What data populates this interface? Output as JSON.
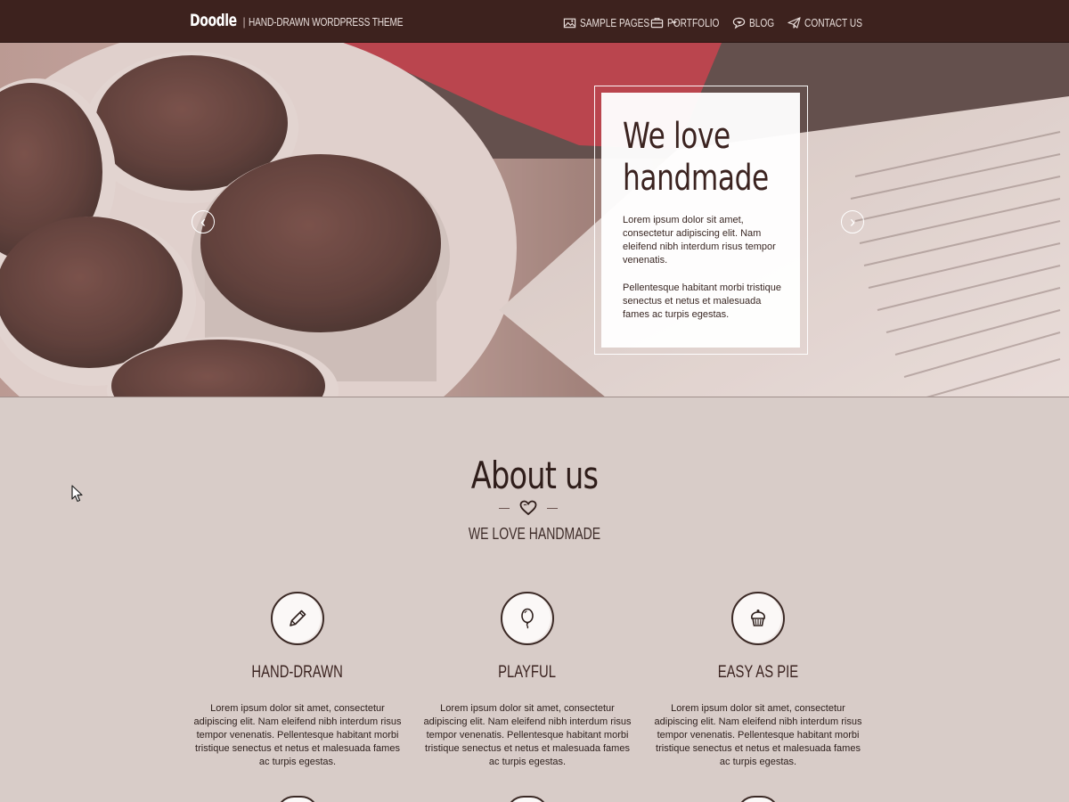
{
  "header": {
    "brand": "Doodle",
    "separator": "|",
    "tagline": "HAND-DRAWN WORDPRESS THEME",
    "nav": [
      {
        "label": "SAMPLE PAGES",
        "icon": "image-icon",
        "dropdown": true
      },
      {
        "label": "PORTFOLIO",
        "icon": "briefcase-icon",
        "dropdown": true
      },
      {
        "label": "BLOG",
        "icon": "speech-bubble-icon",
        "dropdown": false
      },
      {
        "label": "CONTACT US",
        "icon": "paper-plane-icon",
        "dropdown": false
      }
    ]
  },
  "hero": {
    "title_line1": "We love",
    "title_line2": "handmade",
    "paragraph1": "Lorem ipsum dolor sit amet, consectetur adipiscing elit. Nam eleifend nibh interdum risus tempor venenatis.",
    "paragraph2": "Pellentesque habitant morbi tristique senectus et netus et malesuada fames ac turpis egestas.",
    "prev_icon": "chevron-left-icon",
    "next_icon": "chevron-right-icon",
    "prev_glyph": "‹",
    "next_glyph": "›"
  },
  "about": {
    "title": "About us",
    "subtitle": "WE LOVE HANDMADE",
    "divider_icon": "heart-icon",
    "features": [
      {
        "icon": "pencil-icon",
        "title": "HAND-DRAWN",
        "text": "Lorem ipsum dolor sit amet, consectetur adipiscing elit. Nam eleifend nibh interdum risus tempor venenatis. Pellentesque habitant morbi tristique senectus et netus et malesuada fames ac turpis egestas."
      },
      {
        "icon": "balloon-icon",
        "title": "PLAYFUL",
        "text": "Lorem ipsum dolor sit amet, consectetur adipiscing elit. Nam eleifend nibh interdum risus tempor venenatis. Pellentesque habitant morbi tristique senectus et netus et malesuada fames ac turpis egestas."
      },
      {
        "icon": "cupcake-icon",
        "title": "EASY AS PIE",
        "text": "Lorem ipsum dolor sit amet, consectetur adipiscing elit. Nam eleifend nibh interdum risus tempor venenatis. Pellentesque habitant morbi tristique senectus et netus et malesuada fames ac turpis egestas."
      }
    ]
  },
  "colors": {
    "navbar": "#3d221e",
    "page_background": "#d8ccc8",
    "text_dark": "#3b2320"
  }
}
